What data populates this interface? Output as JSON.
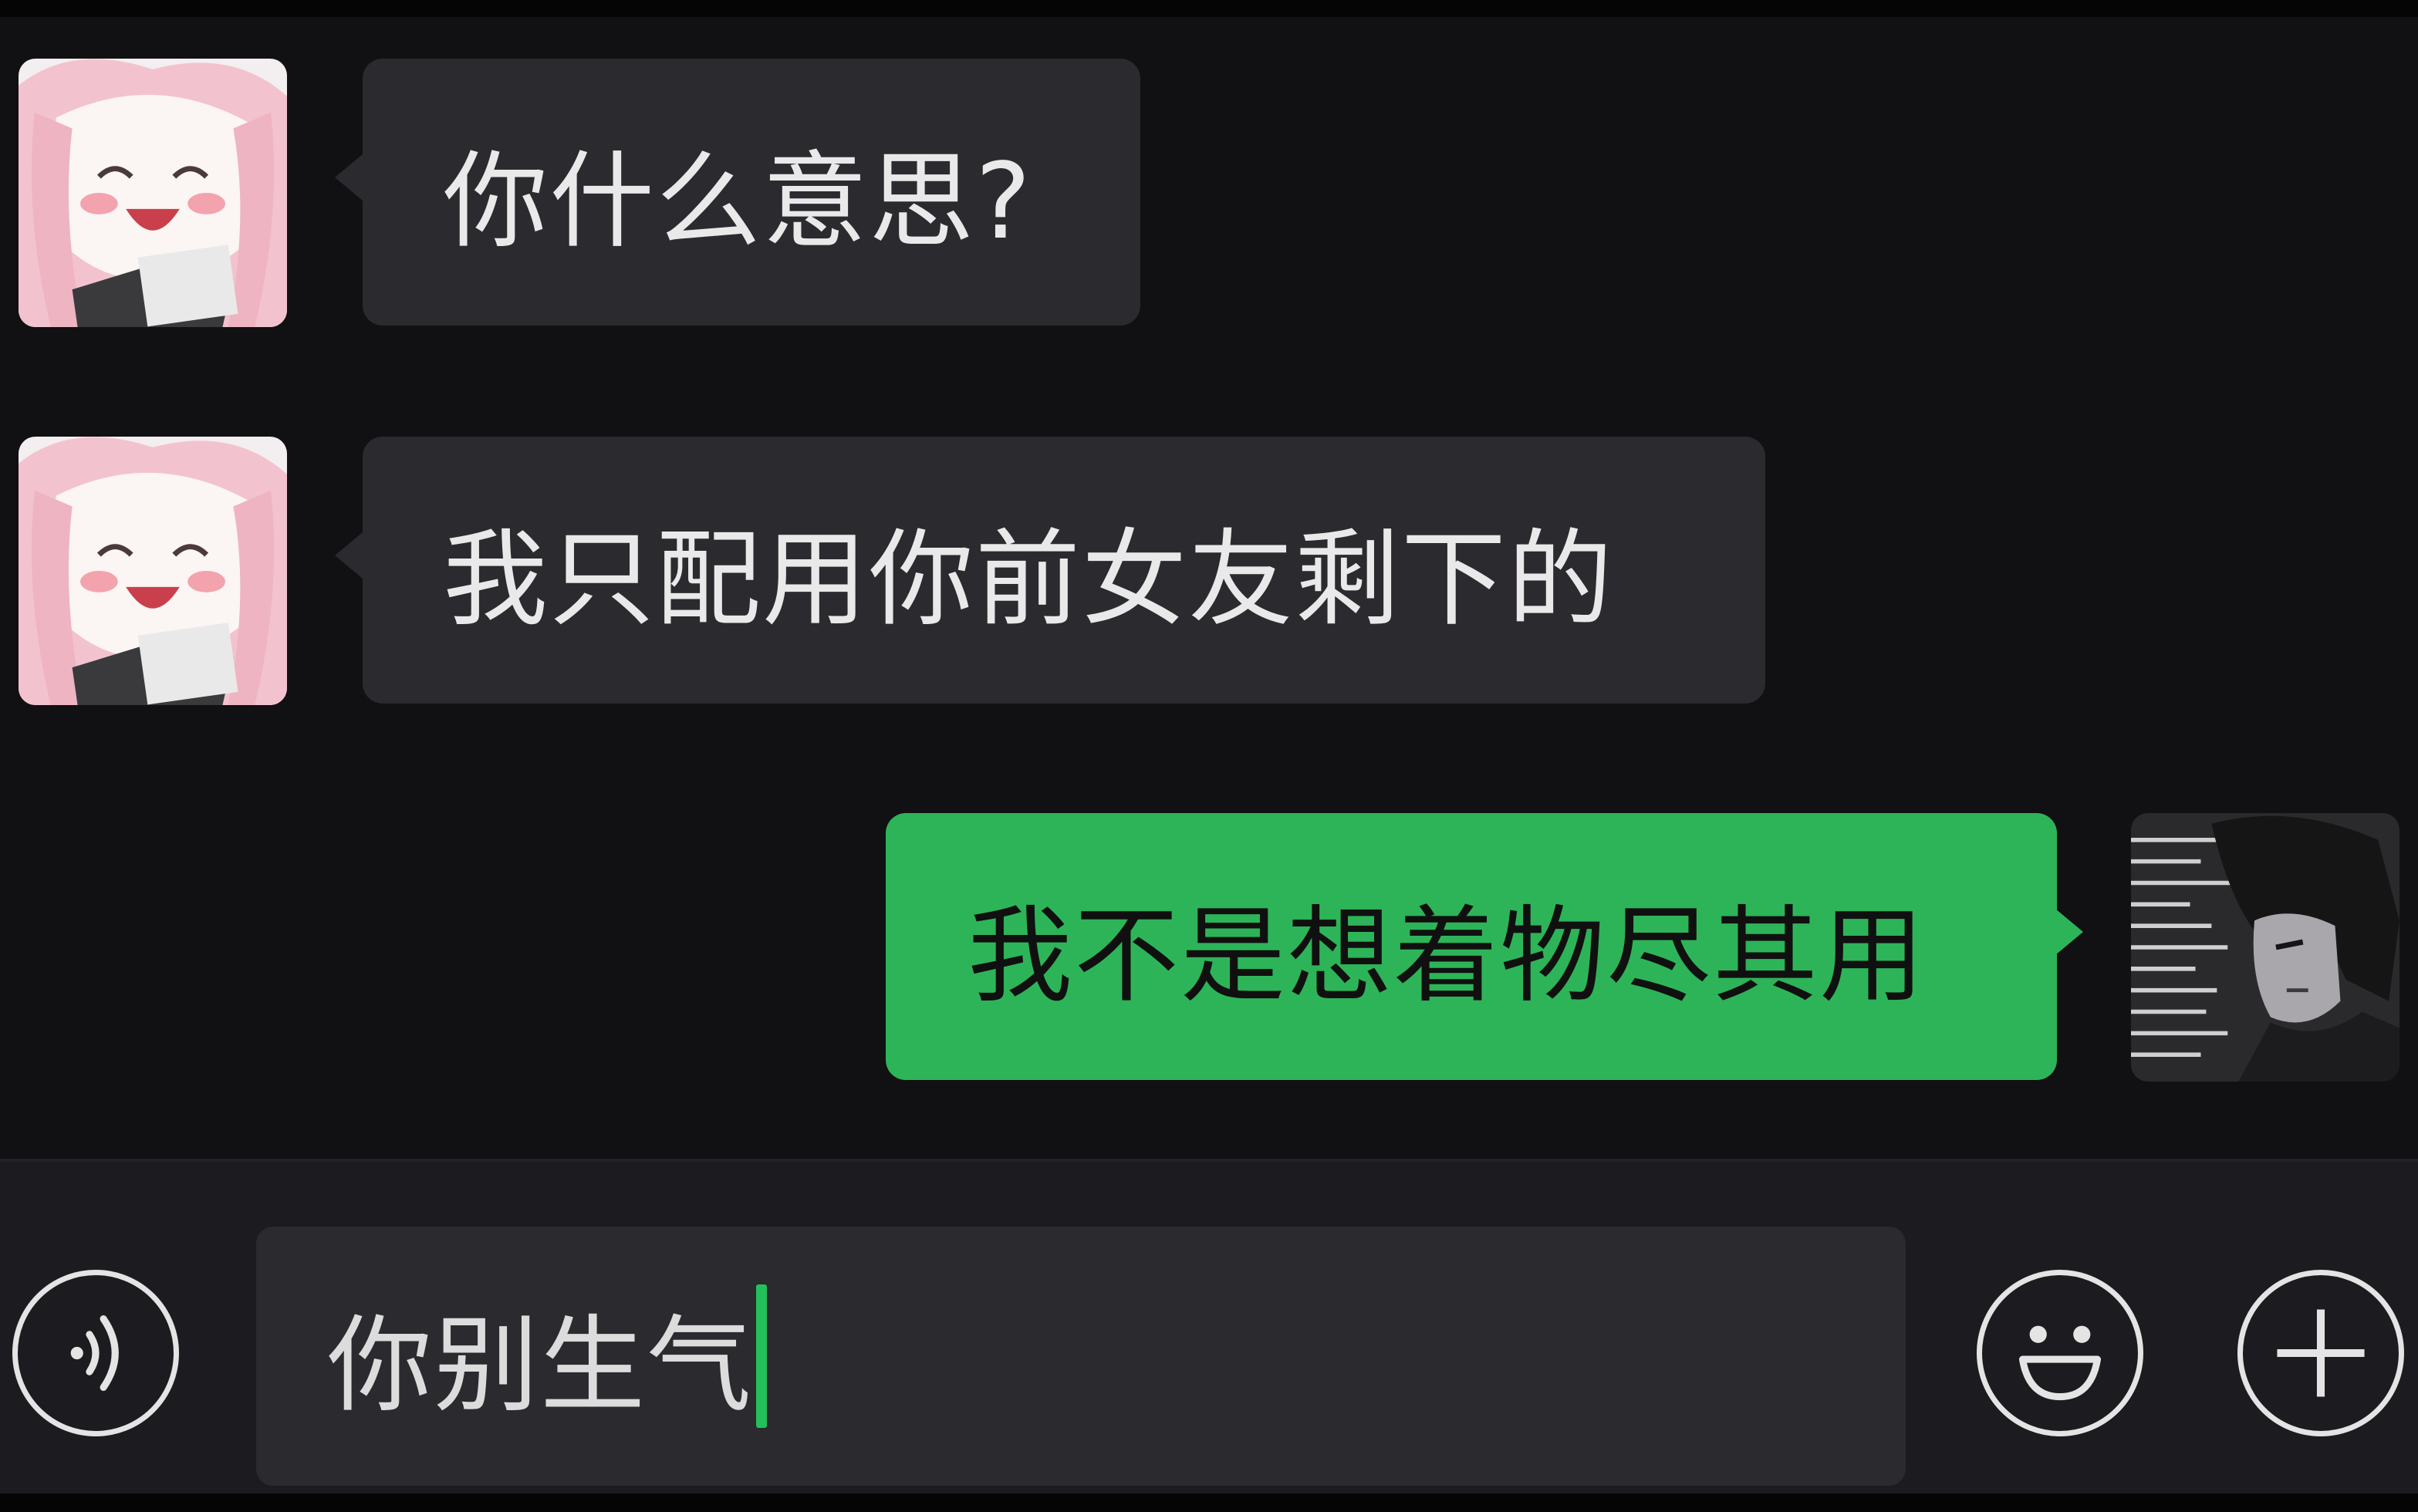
{
  "messages": [
    {
      "side": "in",
      "text": "你什么意思?"
    },
    {
      "side": "in",
      "text": "我只配用你前女友剩下的"
    },
    {
      "side": "out",
      "text": "我不是想着物尽其用"
    }
  ],
  "composer": {
    "draft": "你别生气"
  },
  "icons": {
    "voice": "voice-icon",
    "emoji": "emoji-icon",
    "more": "plus-icon"
  },
  "colors": {
    "background": "#111013",
    "incoming_bubble": "#2b2a2e",
    "outgoing_bubble": "#2db458",
    "caret": "#22c05a"
  }
}
